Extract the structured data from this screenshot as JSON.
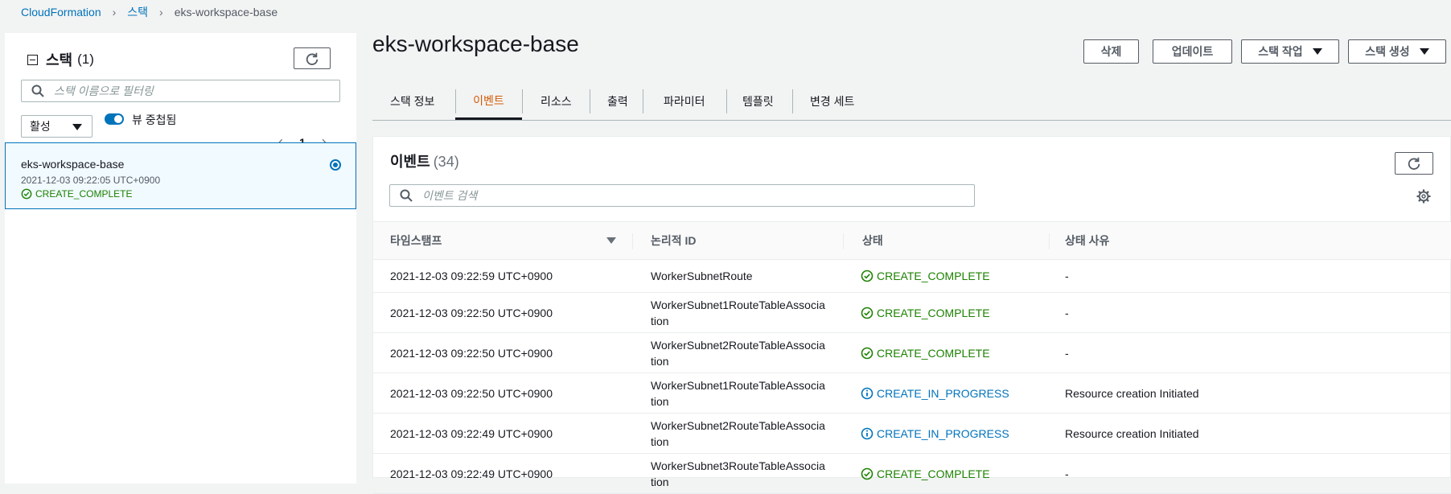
{
  "breadcrumb": {
    "root": "CloudFormation",
    "level2": "스택",
    "current": "eks-workspace-base"
  },
  "stack_list": {
    "title": "스택",
    "count": "(1)",
    "search_placeholder": "스택 이름으로 필터링",
    "filter_value": "활성",
    "toggle_label": "뷰 중첩됨",
    "page": "1",
    "stacks": [
      {
        "name": "eks-workspace-base",
        "time": "2021-12-03 09:22:05 UTC+0900",
        "status": "CREATE_COMPLETE"
      }
    ]
  },
  "detail": {
    "title": "eks-workspace-base",
    "buttons": {
      "delete": "삭제",
      "update": "업데이트",
      "stack_actions": "스택 작업",
      "create_stack": "스택 생성"
    },
    "tabs": [
      "스택 정보",
      "이벤트",
      "리소스",
      "출력",
      "파라미터",
      "템플릿",
      "변경 세트"
    ],
    "active_tab": "이벤트"
  },
  "events": {
    "title": "이벤트",
    "count": "(34)",
    "search_placeholder": "이벤트 검색",
    "columns": [
      "타임스탬프",
      "논리적 ID",
      "상태",
      "상태 사유"
    ],
    "rows": [
      {
        "timestamp": "2021-12-03 09:22:59 UTC+0900",
        "logical_id": "WorkerSubnetRoute",
        "status": "CREATE_COMPLETE",
        "status_type": "complete",
        "reason": "-"
      },
      {
        "timestamp": "2021-12-03 09:22:50 UTC+0900",
        "logical_id": "WorkerSubnet1RouteTableAssocia tion",
        "status": "CREATE_COMPLETE",
        "status_type": "complete",
        "reason": "-"
      },
      {
        "timestamp": "2021-12-03 09:22:50 UTC+0900",
        "logical_id": "WorkerSubnet2RouteTableAssocia tion",
        "status": "CREATE_COMPLETE",
        "status_type": "complete",
        "reason": "-"
      },
      {
        "timestamp": "2021-12-03 09:22:50 UTC+0900",
        "logical_id": "WorkerSubnet1RouteTableAssocia tion",
        "status": "CREATE_IN_PROGRESS",
        "status_type": "progress",
        "reason": "Resource creation Initiated"
      },
      {
        "timestamp": "2021-12-03 09:22:49 UTC+0900",
        "logical_id": "WorkerSubnet2RouteTableAssocia tion",
        "status": "CREATE_IN_PROGRESS",
        "status_type": "progress",
        "reason": "Resource creation Initiated"
      },
      {
        "timestamp": "2021-12-03 09:22:49 UTC+0900",
        "logical_id": "WorkerSubnet3RouteTableAssocia tion",
        "status": "CREATE_COMPLETE",
        "status_type": "complete",
        "reason": "-"
      }
    ]
  },
  "colors": {
    "link": "#0073bb",
    "success": "#1d8102",
    "info": "#0073bb",
    "active_tab": "#d45b07"
  },
  "icons": [
    "search-icon",
    "refresh-icon",
    "gear-icon",
    "success-icon",
    "info-icon",
    "chevron-left-icon",
    "chevron-right-icon"
  ]
}
